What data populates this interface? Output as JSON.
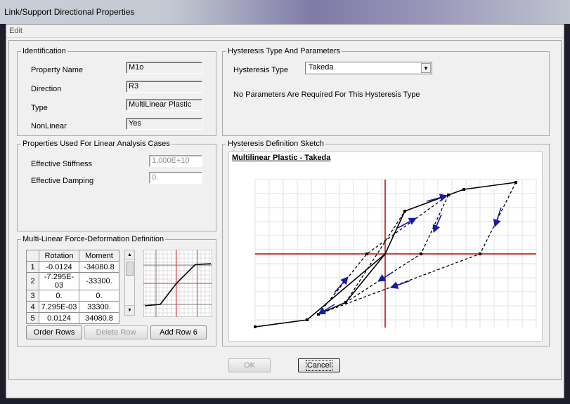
{
  "window": {
    "title": "Link/Support Directional Properties"
  },
  "menu": {
    "edit": "Edit"
  },
  "identification": {
    "legend": "Identification",
    "property_name_label": "Property Name",
    "property_name_value": "M1o",
    "direction_label": "Direction",
    "direction_value": "R3",
    "type_label": "Type",
    "type_value": "MultiLinear Plastic",
    "nonlinear_label": "NonLinear",
    "nonlinear_value": "Yes"
  },
  "linear": {
    "legend": "Properties Used For Linear Analysis Cases",
    "stiffness_label": "Effective Stiffness",
    "stiffness_value": "1.000E+10",
    "damping_label": "Effective Damping",
    "damping_value": "0."
  },
  "multilinear": {
    "legend": "Multi-Linear Force-Deformation Definition",
    "columns": [
      "Rotation",
      "Moment"
    ],
    "rows": [
      {
        "n": "1",
        "rotation": "-0.0124",
        "moment": "-34080.8"
      },
      {
        "n": "2",
        "rotation": "-7.295E-03",
        "moment": "-33300."
      },
      {
        "n": "3",
        "rotation": "0.",
        "moment": "0."
      },
      {
        "n": "4",
        "rotation": "7.295E-03",
        "moment": "33300."
      },
      {
        "n": "5",
        "rotation": "0.0124",
        "moment": "34080.8"
      }
    ],
    "order_rows": "Order Rows",
    "delete_row": "Delete Row",
    "add_row": "Add Row 6"
  },
  "hysteresis": {
    "legend": "Hysteresis Type And Parameters",
    "type_label": "Hysteresis Type",
    "type_value": "Takeda",
    "no_params": "No Parameters Are Required For This Hysteresis Type"
  },
  "sketch": {
    "legend": "Hysteresis Definition Sketch",
    "title": "Multilinear Plastic - Takeda"
  },
  "footer": {
    "ok": "OK",
    "cancel": "Cancel"
  },
  "colors": {
    "axis": "#c00000",
    "arrow": "#1a1aa8",
    "grid": "#d9d9d9"
  }
}
